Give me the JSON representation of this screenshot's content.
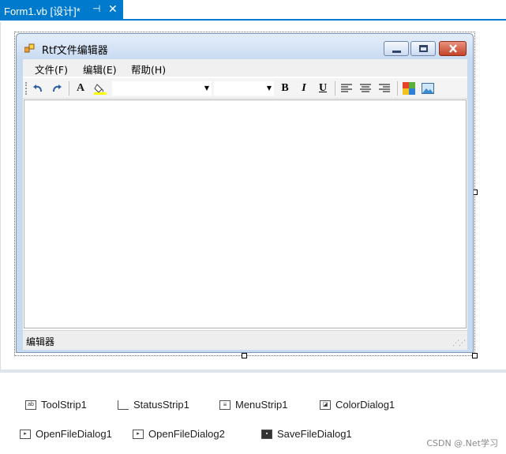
{
  "tab": {
    "title": "Form1.vb [设计]*",
    "pin_icon": "⊣",
    "close_icon": "✕"
  },
  "form": {
    "title": "Rtf文件编辑器",
    "menu": [
      {
        "label": "文件(F)"
      },
      {
        "label": "编辑(E)"
      },
      {
        "label": "帮助(H)"
      }
    ],
    "toolbar": {
      "undo_icon": "undo-icon",
      "redo_icon": "redo-icon",
      "font_icon_text": "A",
      "bold": "B",
      "italic": "I",
      "underline": "U"
    },
    "status_label": "编辑器"
  },
  "tray": {
    "items": [
      {
        "label": "ToolStrip1"
      },
      {
        "label": "StatusStrip1"
      },
      {
        "label": "MenuStrip1"
      },
      {
        "label": "ColorDialog1"
      },
      {
        "label": "OpenFileDialog1"
      },
      {
        "label": "OpenFileDialog2"
      },
      {
        "label": "SaveFileDialog1"
      }
    ]
  },
  "watermark": "CSDN @.Net学习",
  "colors": {
    "accent": "#007acc",
    "title_bar": "#c9dbf1",
    "close_button": "#c2432a"
  }
}
